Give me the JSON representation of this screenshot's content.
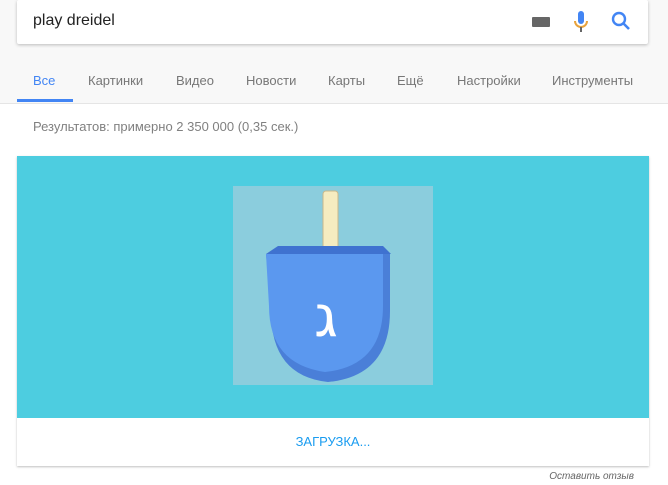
{
  "search": {
    "query": "play dreidel"
  },
  "tabs": [
    {
      "label": "Все"
    },
    {
      "label": "Картинки"
    },
    {
      "label": "Видео"
    },
    {
      "label": "Новости"
    },
    {
      "label": "Карты"
    },
    {
      "label": "Ещё"
    },
    {
      "label": "Настройки"
    },
    {
      "label": "Инструменты"
    }
  ],
  "results_stats": "Результатов: примерно 2 350 000 (0,35 сек.)",
  "card": {
    "loading_label": "ЗАГРУЗКА...",
    "dreidel_letter": "ג"
  },
  "feedback": "Оставить отзыв",
  "colors": {
    "accent": "#4285f4",
    "teal": "#4dcde0"
  }
}
